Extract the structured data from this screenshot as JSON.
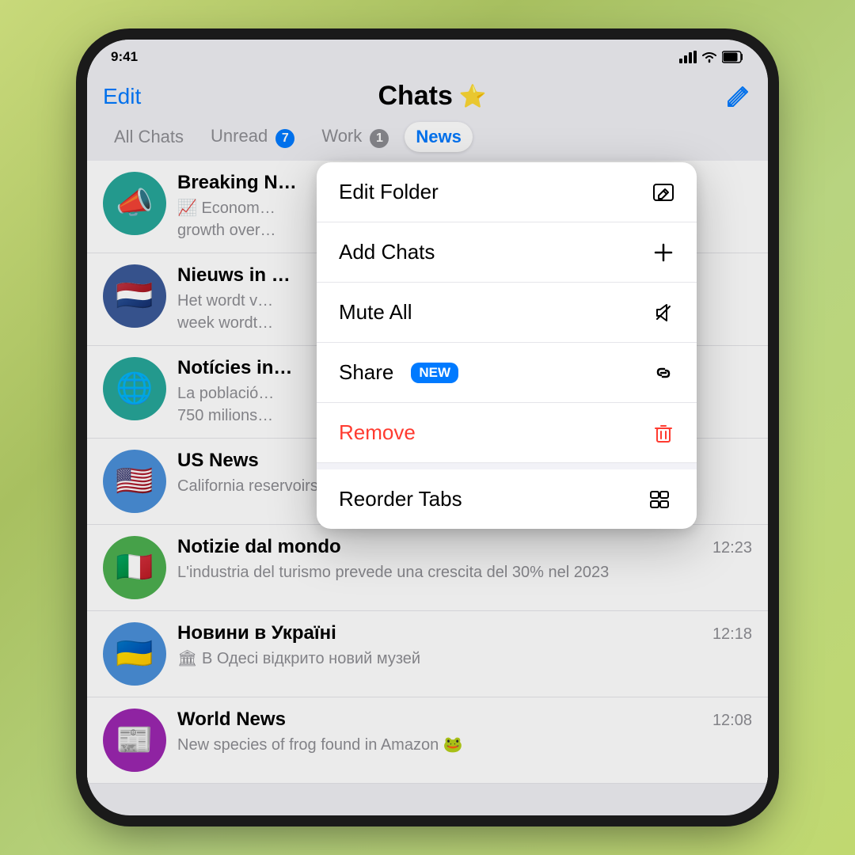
{
  "statusBar": {
    "time": "9:41"
  },
  "header": {
    "editLabel": "Edit",
    "titleLabel": "Chats",
    "starIcon": "★"
  },
  "tabs": [
    {
      "id": "all-chats",
      "label": "All Chats",
      "badge": null,
      "active": false
    },
    {
      "id": "unread",
      "label": "Unread",
      "badge": "7",
      "badgeColor": "blue",
      "active": false
    },
    {
      "id": "work",
      "label": "Work",
      "badge": "1",
      "badgeColor": "gray",
      "active": false
    },
    {
      "id": "news",
      "label": "News",
      "badge": null,
      "active": true
    }
  ],
  "chats": [
    {
      "id": "breaking-news",
      "name": "Breaking N…",
      "preview": "📈 Econom… growth over…",
      "time": "",
      "avatar": "📣",
      "avatarClass": "avatar-megaphone"
    },
    {
      "id": "nieuws-nl",
      "name": "Nieuws in …",
      "preview": "Het wordt v… week wordt…",
      "time": "",
      "avatar": "🇳🇱",
      "avatarClass": "avatar-netherlands"
    },
    {
      "id": "noticies",
      "name": "Notícies in…",
      "preview": "La població… 750 milions…",
      "time": "",
      "avatar": "🌐",
      "avatarClass": "avatar-globe"
    },
    {
      "id": "us-news",
      "name": "US News",
      "preview": "California reservoirs hit highest levels in 3 years 💧",
      "time": "",
      "avatar": "🇺🇸",
      "avatarClass": "avatar-us"
    },
    {
      "id": "notizie-dal-mondo",
      "name": "Notizie dal mondo",
      "preview": "L'industria del turismo prevede una crescita del 30% nel 2023",
      "time": "12:23",
      "avatar": "🇮🇹",
      "avatarClass": "avatar-italy"
    },
    {
      "id": "novyny-ukraine",
      "name": "Новини в Україні",
      "preview": "🏛 В Одесі відкрито новий музей",
      "time": "12:18",
      "avatar": "🇺🇦",
      "avatarClass": "avatar-ukraine"
    },
    {
      "id": "world-news",
      "name": "World News",
      "preview": "New species of frog found in Amazon 🐸",
      "time": "12:08",
      "avatar": "📰",
      "avatarClass": "avatar-newspaper"
    }
  ],
  "contextMenu": {
    "items": [
      {
        "id": "edit-folder",
        "label": "Edit Folder",
        "iconType": "edit",
        "color": "black"
      },
      {
        "id": "add-chats",
        "label": "Add Chats",
        "iconType": "plus",
        "color": "black"
      },
      {
        "id": "mute-all",
        "label": "Mute All",
        "iconType": "bell-off",
        "color": "black"
      },
      {
        "id": "share",
        "label": "Share",
        "badge": "NEW",
        "iconType": "link",
        "color": "black"
      },
      {
        "id": "remove",
        "label": "Remove",
        "iconType": "trash",
        "color": "red"
      },
      {
        "id": "reorder-tabs",
        "label": "Reorder Tabs",
        "iconType": "reorder",
        "color": "black"
      }
    ]
  }
}
